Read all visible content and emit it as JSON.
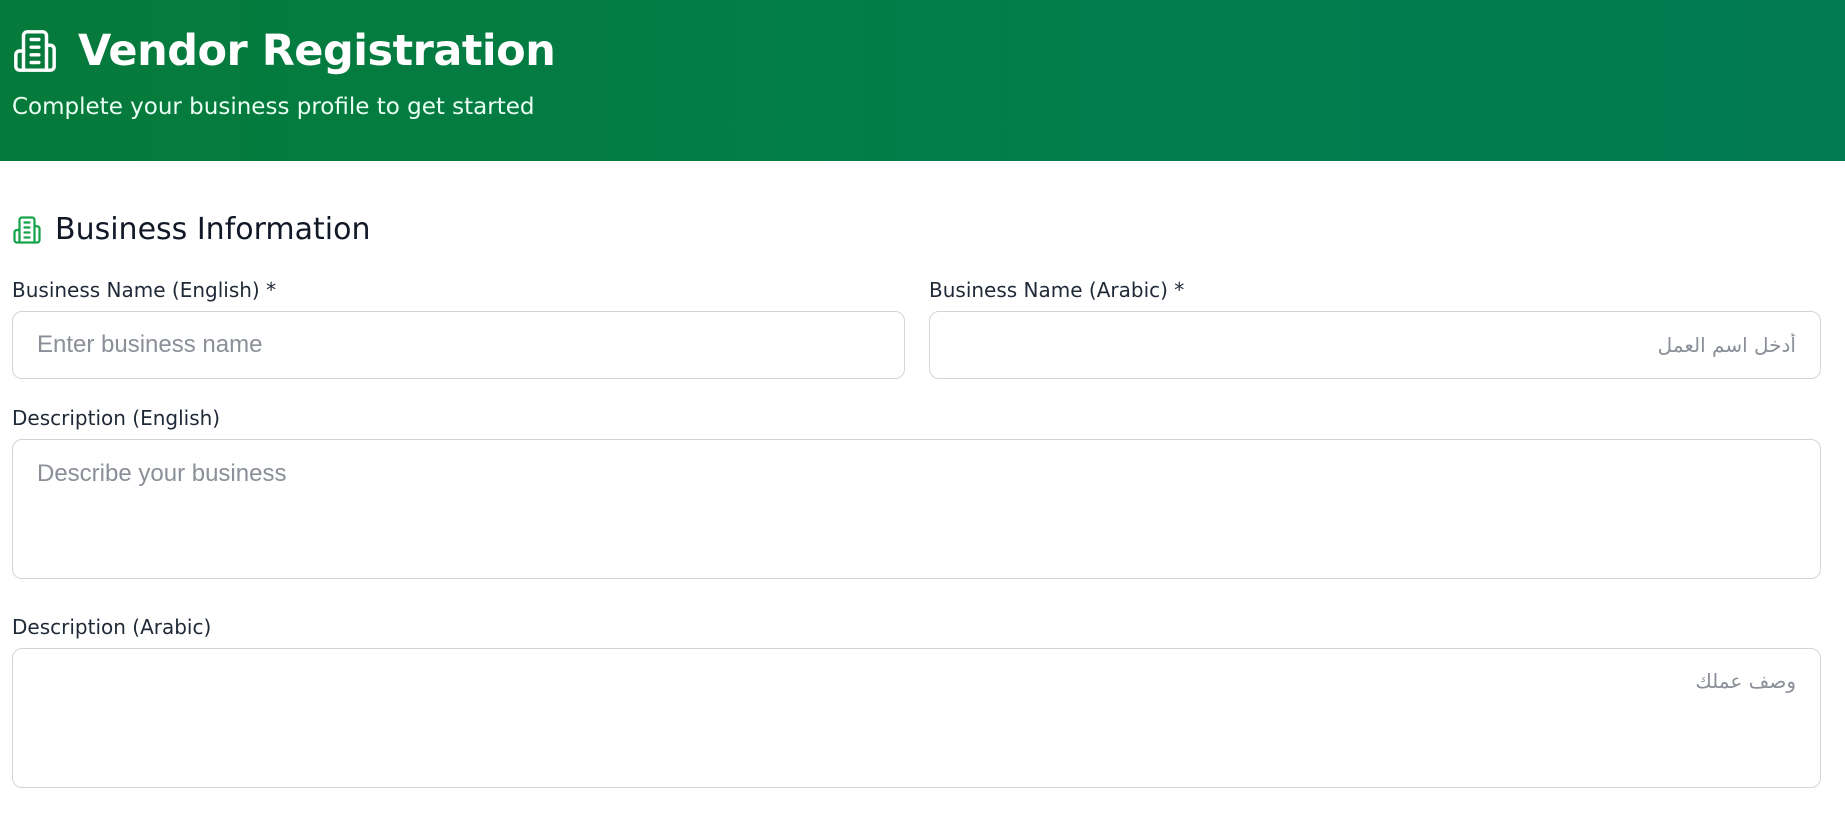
{
  "header": {
    "title": "Vendor Registration",
    "subtitle": "Complete your business profile to get started",
    "icon": "building-icon",
    "gradient_start": "#067a3a",
    "gradient_end": "#017a52"
  },
  "section": {
    "title": "Business Information",
    "icon": "building-icon",
    "accent_color": "#16a34a"
  },
  "fields": {
    "business_name_en": {
      "label": "Business Name (English) *",
      "value": "",
      "placeholder": "Enter business name"
    },
    "business_name_ar": {
      "label": "Business Name (Arabic) *",
      "value": "",
      "placeholder": "أدخل اسم العمل"
    },
    "description_en": {
      "label": "Description (English)",
      "value": "",
      "placeholder": "Describe your business"
    },
    "description_ar": {
      "label": "Description (Arabic)",
      "value": "",
      "placeholder": "وصف عملك"
    }
  }
}
